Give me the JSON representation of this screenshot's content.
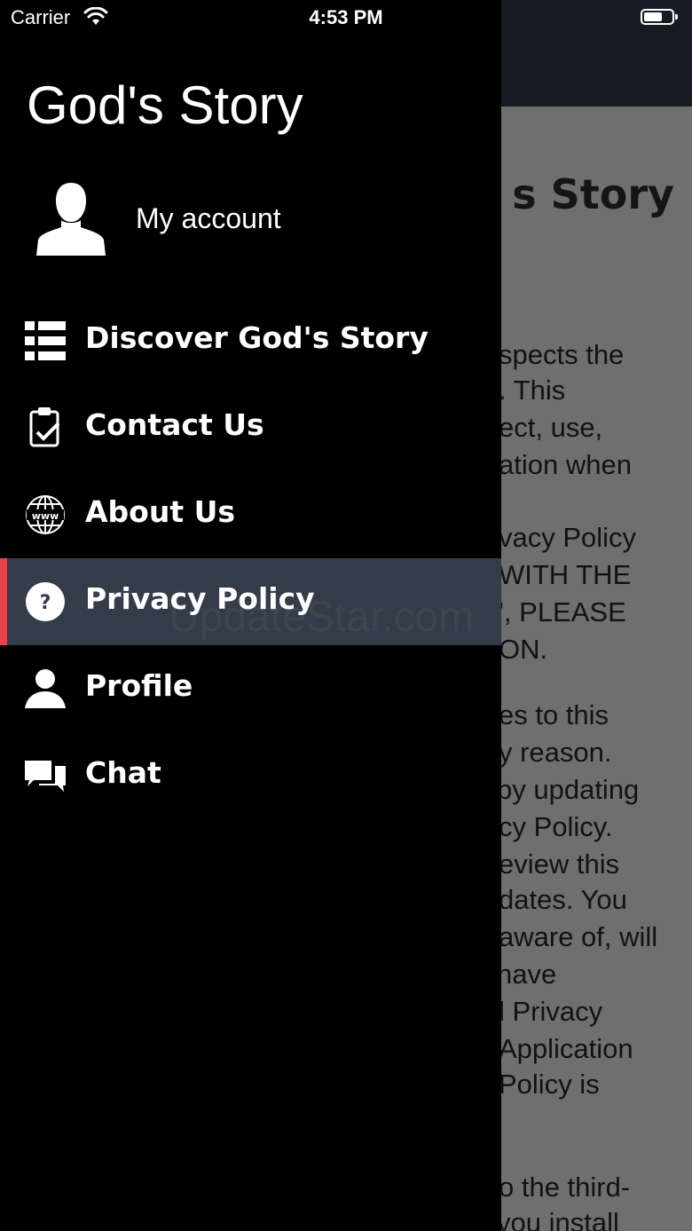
{
  "status_bar": {
    "carrier": "Carrier",
    "time": "4:53 PM"
  },
  "background_page": {
    "title": "s Story",
    "lines": [
      "spects the",
      ". This",
      "ect, use,",
      "ation when",
      "",
      "vacy Policy",
      "WITH THE",
      "', PLEASE",
      "ON.",
      "",
      "es to this",
      "y reason.",
      " by updating",
      "cy Policy.",
      "eview this",
      "dates. You",
      "aware of, will",
      " have",
      "l Privacy",
      "Application",
      "Policy is",
      "",
      "",
      "o the third-",
      " you install"
    ]
  },
  "drawer": {
    "app_title": "God's Story",
    "account_label": "My account",
    "menu": [
      {
        "label": "Discover God's Story",
        "icon": "list-icon",
        "active": false
      },
      {
        "label": "Contact Us",
        "icon": "clipboard-check-icon",
        "active": false
      },
      {
        "label": "About Us",
        "icon": "globe-www-icon",
        "active": false
      },
      {
        "label": "Privacy Policy",
        "icon": "question-circle-icon",
        "active": true
      },
      {
        "label": "Profile",
        "icon": "person-icon",
        "active": false
      },
      {
        "label": "Chat",
        "icon": "chat-bubbles-icon",
        "active": false
      }
    ]
  },
  "colors": {
    "active_bg": "#333c48",
    "active_accent": "#e8424b",
    "drawer_bg": "#000000"
  },
  "watermark": "UpdateStar.com"
}
